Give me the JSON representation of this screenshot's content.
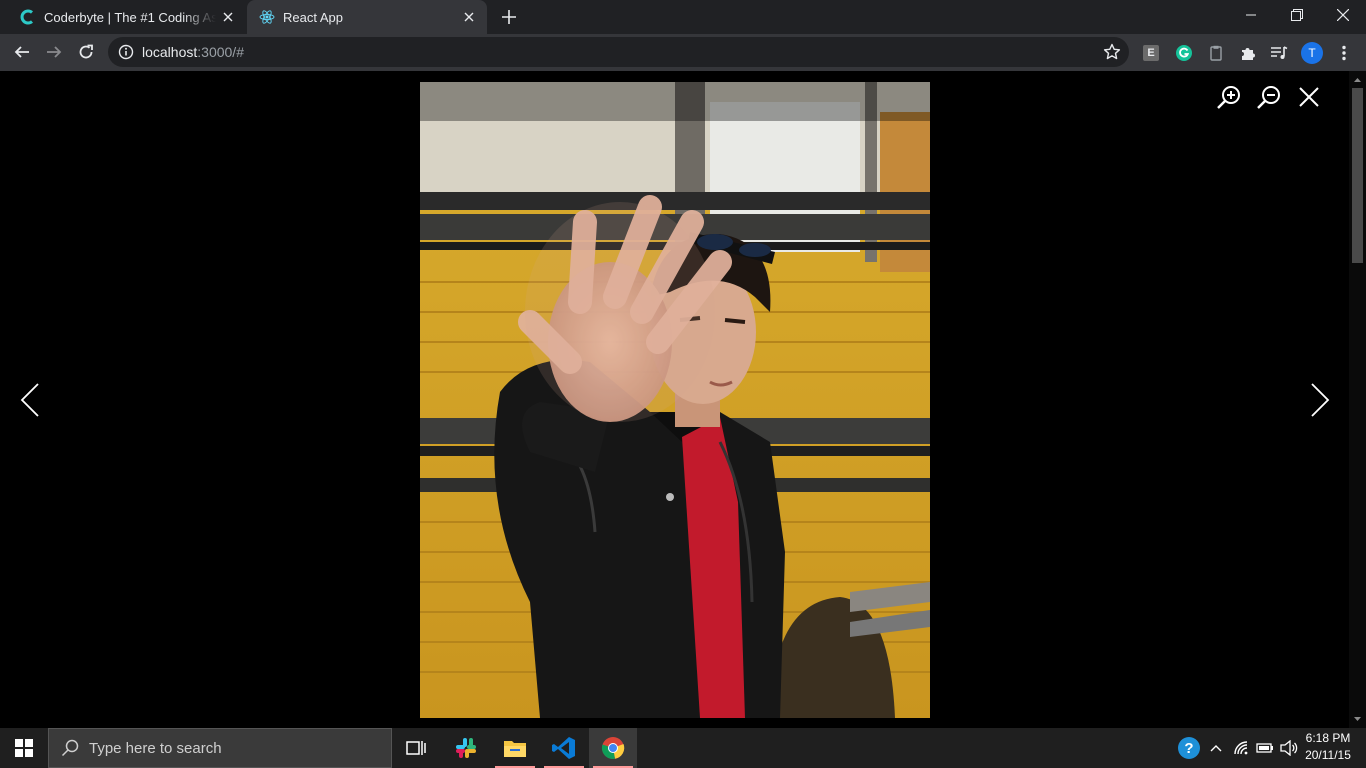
{
  "browser": {
    "tabs": [
      {
        "title": "Coderbyte | The #1 Coding Assessment",
        "favicon": "coderbyte-icon",
        "active": false
      },
      {
        "title": "React App",
        "favicon": "react-icon",
        "active": true
      }
    ],
    "url_host": "localhost",
    "url_rest": ":3000/#",
    "profile_initial": "T",
    "extensions": [
      "e-extension-icon",
      "grammarly-icon",
      "clipboard-extension-icon",
      "puzzle-icon",
      "media-control-icon"
    ]
  },
  "viewer": {
    "image_alt": "Man in black leather jacket holding hand out in front of yellow school bus",
    "controls": [
      "zoom-in-icon",
      "zoom-out-icon",
      "close-icon"
    ],
    "nav": [
      "previous-arrow-icon",
      "next-arrow-icon"
    ]
  },
  "taskbar": {
    "search_placeholder": "Type here to search",
    "apps": [
      "task-view-icon",
      "slack-icon",
      "file-explorer-icon",
      "vscode-icon",
      "chrome-icon"
    ],
    "time": "6:18 PM",
    "date": "20/11/15"
  },
  "colors": {
    "tabstrip": "#202124",
    "toolbar": "#35363a",
    "profile": "#1a73e8",
    "bus_yellow": "#d7a928"
  }
}
